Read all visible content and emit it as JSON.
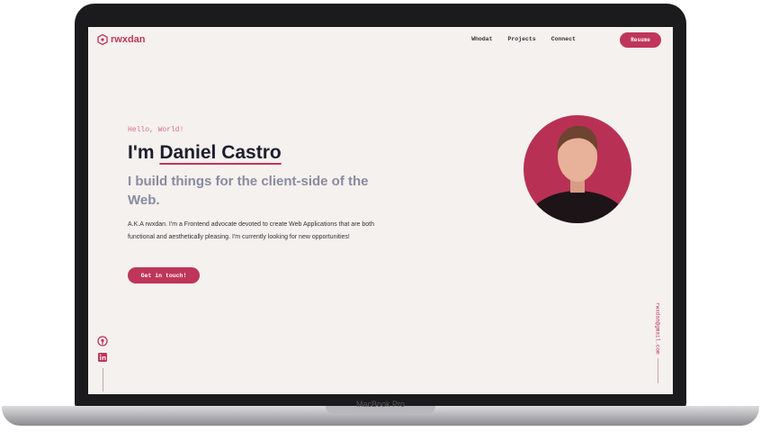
{
  "nav": {
    "logo_text": "rwxdan",
    "links": [
      "Whodat",
      "Projects",
      "Connect"
    ],
    "resume_label": "Resume"
  },
  "hero": {
    "greeting": "Hello, World!",
    "headline_prefix": "I'm ",
    "name": "Daniel Castro",
    "subtitle": "I build things for the client-side of the Web.",
    "bio": "A.K.A rwxdan. I'm a Frontend advocate devoted to create Web Applications that are both functional and aesthetically pleasing. I'm currently looking for new opportunities!",
    "cta_label": "Get in touch!"
  },
  "social": {
    "icons": [
      "github-icon",
      "linkedin-icon"
    ]
  },
  "email_text": "rwxdan@gmail.com",
  "device_label": "MacBook Pro",
  "colors": {
    "accent": "#c0355a",
    "background": "#f4f1ee",
    "heading": "#1d1d2e",
    "subtitle": "#8a8aa0"
  }
}
